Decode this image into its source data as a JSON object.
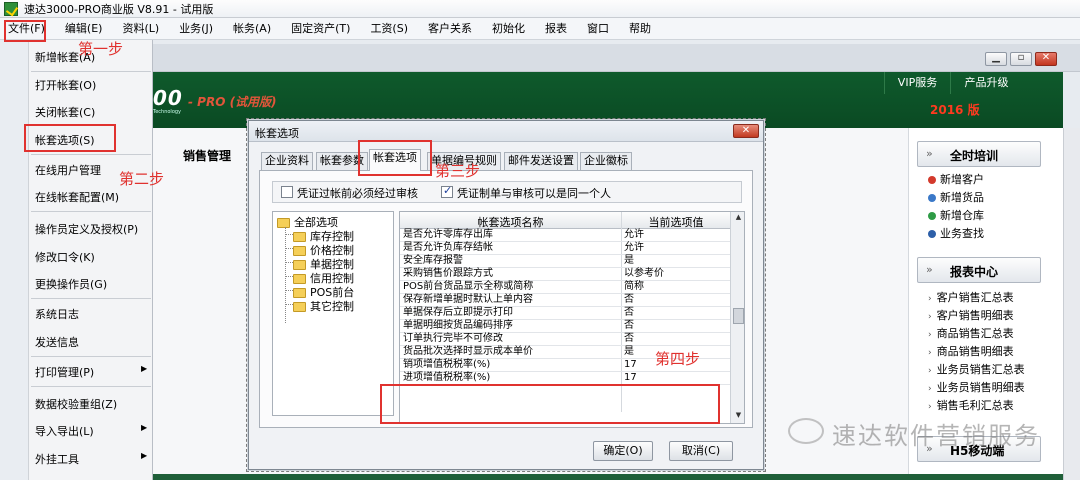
{
  "window": {
    "title": "速达3000-PRO商业版 V8.91 - 试用版"
  },
  "menubar": [
    {
      "id": "file",
      "label": "文件(F)"
    },
    {
      "id": "edit",
      "label": "编辑(E)"
    },
    {
      "id": "data",
      "label": "资料(L)"
    },
    {
      "id": "business",
      "label": "业务(J)"
    },
    {
      "id": "accounts",
      "label": "帐务(A)"
    },
    {
      "id": "assets",
      "label": "固定资产(T)"
    },
    {
      "id": "salary",
      "label": "工资(S)"
    },
    {
      "id": "crm",
      "label": "客户关系"
    },
    {
      "id": "init",
      "label": "初始化"
    },
    {
      "id": "reports",
      "label": "报表"
    },
    {
      "id": "window",
      "label": "窗口"
    },
    {
      "id": "help",
      "label": "帮助"
    }
  ],
  "file_menu": {
    "items": [
      {
        "label": "新增帐套(A)"
      },
      {
        "label": "打开帐套(O)"
      },
      {
        "label": "关闭帐套(C)"
      },
      {
        "label": "帐套选项(S)"
      },
      {
        "label": "在线用户管理"
      },
      {
        "label": "在线帐套配置(M)"
      },
      {
        "label": "操作员定义及授权(P)"
      },
      {
        "label": "修改口令(K)"
      },
      {
        "label": "更换操作员(G)"
      },
      {
        "label": "系统日志"
      },
      {
        "label": "发送信息"
      },
      {
        "label": "打印管理(P)",
        "submenu": true
      },
      {
        "label": "数据校验重组(Z)"
      },
      {
        "label": "导入导出(L)",
        "submenu": true
      },
      {
        "label": "外挂工具",
        "submenu": true
      }
    ]
  },
  "annotations": {
    "step1": "第一步",
    "step2": "第二步",
    "step3": "第三步",
    "step4": "第四步"
  },
  "banner": {
    "logo": "00",
    "pro": "- PRO (试用版)",
    "sub": "Technology",
    "vip": "VIP服务",
    "upgrade": "产品升级",
    "year": "2016 版"
  },
  "main": {
    "sales_tab": "销售管理"
  },
  "right_panel": {
    "training_title": "全时培训",
    "training_items": [
      "新增客户",
      "新增货品",
      "新增仓库",
      "业务查找"
    ],
    "report_title": "报表中心",
    "report_items": [
      "客户销售汇总表",
      "客户销售明细表",
      "商品销售汇总表",
      "商品销售明细表",
      "业务员销售汇总表",
      "业务员销售明细表",
      "销售毛利汇总表"
    ],
    "mobile_title": "H5移动端",
    "dot_colors": [
      "#d33a2c",
      "#3a78c8",
      "#2e9b46",
      "#2d5fa8"
    ]
  },
  "watermark": "速达软件营销服务",
  "dialog": {
    "title": "帐套选项",
    "tabs": [
      "企业资料",
      "帐套参数",
      "帐套选项",
      "单据编号规则",
      "邮件发送设置",
      "企业徽标"
    ],
    "active_tab": 2,
    "checkboxes": [
      {
        "label": "凭证过帐前必须经过审核",
        "checked": false
      },
      {
        "label": "凭证制单与审核可以是同一个人",
        "checked": true
      }
    ],
    "tree": {
      "root": "全部选项",
      "children": [
        "库存控制",
        "价格控制",
        "单据控制",
        "信用控制",
        "POS前台",
        "其它控制"
      ]
    },
    "grid": {
      "col_name": "帐套选项名称",
      "col_value": "当前选项值",
      "rows": [
        {
          "name": "是否允许零库存出库",
          "value": "允许"
        },
        {
          "name": "是否允许负库存结帐",
          "value": "允许"
        },
        {
          "name": "安全库存报警",
          "value": "是"
        },
        {
          "name": "采购销售价跟踪方式",
          "value": "以参考价"
        },
        {
          "name": "POS前台货品显示全称或简称",
          "value": "简称"
        },
        {
          "name": "保存新增单据时默认上单内容",
          "value": "否"
        },
        {
          "name": "单据保存后立即提示打印",
          "value": "否"
        },
        {
          "name": "单据明细按货品编码排序",
          "value": "否"
        },
        {
          "name": "订单执行完毕不可修改",
          "value": "否"
        },
        {
          "name": "货品批次选择时显示成本单价",
          "value": "是"
        },
        {
          "name": "销项增值税税率(%)",
          "value": "17"
        },
        {
          "name": "进项增值税税率(%)",
          "value": "17"
        }
      ]
    },
    "ok_label": "确定(O)",
    "cancel_label": "取消(C)"
  }
}
